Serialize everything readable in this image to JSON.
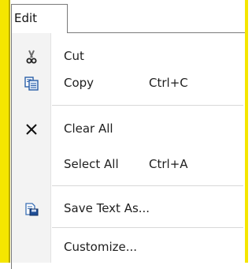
{
  "menu_bar": {
    "tab_label": "Edit"
  },
  "menu": {
    "items": [
      {
        "label": "Cut",
        "shortcut": "",
        "icon": "scissors-icon"
      },
      {
        "label": "Copy",
        "shortcut": "Ctrl+C",
        "icon": "copy-icon"
      },
      {
        "label": "Clear All",
        "shortcut": "",
        "icon": "close-x-icon"
      },
      {
        "label": "Select All",
        "shortcut": "Ctrl+A",
        "icon": ""
      },
      {
        "label": "Save Text As...",
        "shortcut": "",
        "icon": "save-text-icon"
      },
      {
        "label": "Customize...",
        "shortcut": "",
        "icon": ""
      }
    ]
  },
  "colors": {
    "accent_border": "#f5e600",
    "gutter": "#f3f3f3",
    "separator": "#d8d8d8"
  }
}
